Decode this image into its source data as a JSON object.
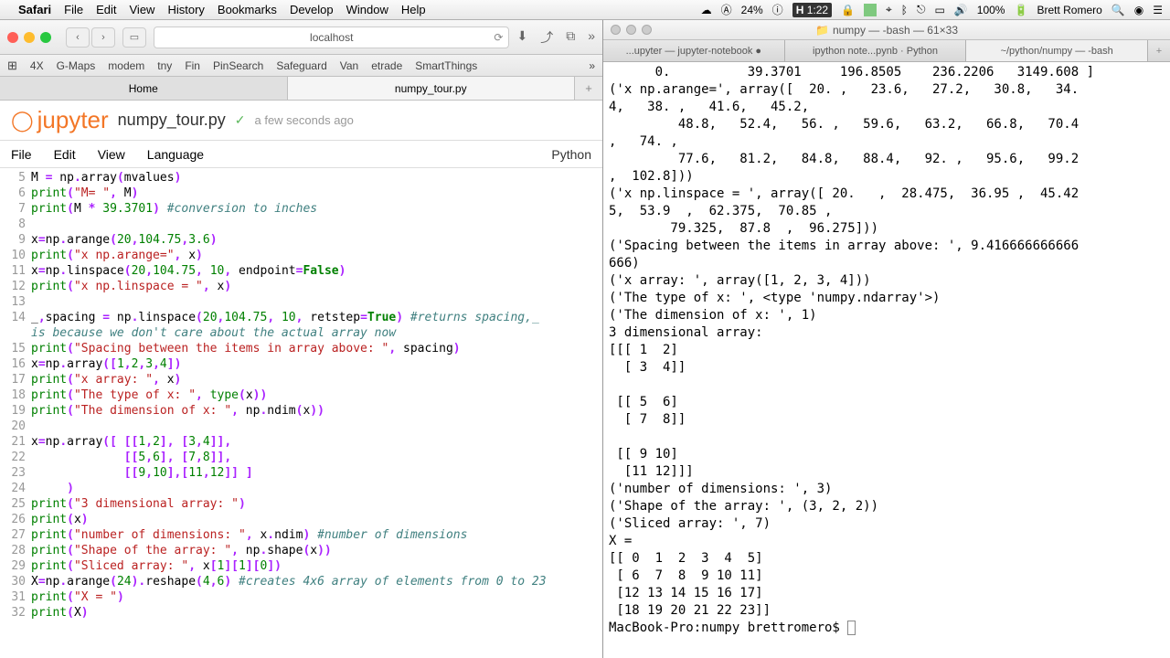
{
  "menubar": {
    "app": "Safari",
    "items": [
      "File",
      "Edit",
      "View",
      "History",
      "Bookmarks",
      "Develop",
      "Window",
      "Help"
    ],
    "zoom": "24%",
    "time": "1:22",
    "battery": "100%",
    "user": "Brett Romero"
  },
  "safari": {
    "url": "localhost",
    "favorites": [
      "4X",
      "G-Maps",
      "modem",
      "tny",
      "Fin",
      "PinSearch",
      "Safeguard",
      "Van",
      "etrade",
      "SmartThings"
    ],
    "tabs": [
      "Home",
      "numpy_tour.py"
    ],
    "active_tab": 1
  },
  "jupyter": {
    "logo": "jupyter",
    "filename": "numpy_tour.py",
    "saved": "a few seconds ago",
    "menu": [
      "File",
      "Edit",
      "View",
      "Language"
    ],
    "kernel": "Python"
  },
  "code": [
    {
      "n": 5,
      "tokens": [
        [
          "",
          "M "
        ],
        [
          "op",
          "="
        ],
        [
          "",
          " np"
        ],
        [
          "op",
          "."
        ],
        [
          "",
          "array"
        ],
        [
          "op",
          "("
        ],
        [
          "",
          "mvalues"
        ],
        [
          "op",
          ")"
        ]
      ]
    },
    {
      "n": 6,
      "tokens": [
        [
          "builtin",
          "print"
        ],
        [
          "op",
          "("
        ],
        [
          "str",
          "\"M= \""
        ],
        [
          "op",
          ","
        ],
        [
          "",
          " M"
        ],
        [
          "op",
          ")"
        ]
      ]
    },
    {
      "n": 7,
      "tokens": [
        [
          "builtin",
          "print"
        ],
        [
          "op",
          "("
        ],
        [
          "",
          "M "
        ],
        [
          "op",
          "*"
        ],
        [
          "",
          " "
        ],
        [
          "num",
          "39.3701"
        ],
        [
          "op",
          ")"
        ],
        [
          "",
          " "
        ],
        [
          "com",
          "#conversion to inches"
        ]
      ]
    },
    {
      "n": 8,
      "tokens": []
    },
    {
      "n": 9,
      "tokens": [
        [
          "",
          "x"
        ],
        [
          "op",
          "="
        ],
        [
          "",
          "np"
        ],
        [
          "op",
          "."
        ],
        [
          "",
          "arange"
        ],
        [
          "op",
          "("
        ],
        [
          "num",
          "20"
        ],
        [
          "op",
          ","
        ],
        [
          "num",
          "104.75"
        ],
        [
          "op",
          ","
        ],
        [
          "num",
          "3.6"
        ],
        [
          "op",
          ")"
        ]
      ]
    },
    {
      "n": 10,
      "tokens": [
        [
          "builtin",
          "print"
        ],
        [
          "op",
          "("
        ],
        [
          "str",
          "\"x np.arange=\""
        ],
        [
          "op",
          ","
        ],
        [
          "",
          " x"
        ],
        [
          "op",
          ")"
        ]
      ]
    },
    {
      "n": 11,
      "tokens": [
        [
          "",
          "x"
        ],
        [
          "op",
          "="
        ],
        [
          "",
          "np"
        ],
        [
          "op",
          "."
        ],
        [
          "",
          "linspace"
        ],
        [
          "op",
          "("
        ],
        [
          "num",
          "20"
        ],
        [
          "op",
          ","
        ],
        [
          "num",
          "104.75"
        ],
        [
          "op",
          ","
        ],
        [
          "",
          " "
        ],
        [
          "num",
          "10"
        ],
        [
          "op",
          ","
        ],
        [
          "",
          " endpoint"
        ],
        [
          "op",
          "="
        ],
        [
          "bool",
          "False"
        ],
        [
          "op",
          ")"
        ]
      ]
    },
    {
      "n": 12,
      "tokens": [
        [
          "builtin",
          "print"
        ],
        [
          "op",
          "("
        ],
        [
          "str",
          "\"x np.linspace = \""
        ],
        [
          "op",
          ","
        ],
        [
          "",
          " x"
        ],
        [
          "op",
          ")"
        ]
      ]
    },
    {
      "n": 13,
      "tokens": []
    },
    {
      "n": 14,
      "tokens": [
        [
          "",
          "_"
        ],
        [
          "op",
          ","
        ],
        [
          "",
          "spacing "
        ],
        [
          "op",
          "="
        ],
        [
          "",
          " np"
        ],
        [
          "op",
          "."
        ],
        [
          "",
          "linspace"
        ],
        [
          "op",
          "("
        ],
        [
          "num",
          "20"
        ],
        [
          "op",
          ","
        ],
        [
          "num",
          "104.75"
        ],
        [
          "op",
          ","
        ],
        [
          "",
          " "
        ],
        [
          "num",
          "10"
        ],
        [
          "op",
          ","
        ],
        [
          "",
          " retstep"
        ],
        [
          "op",
          "="
        ],
        [
          "bool",
          "True"
        ],
        [
          "op",
          ")"
        ],
        [
          "",
          " "
        ],
        [
          "com",
          "#returns spacing,_ "
        ]
      ]
    },
    {
      "n": "",
      "tokens": [
        [
          "com",
          "is because we don't care about the actual array now"
        ]
      ]
    },
    {
      "n": 15,
      "tokens": [
        [
          "builtin",
          "print"
        ],
        [
          "op",
          "("
        ],
        [
          "str",
          "\"Spacing between the items in array above: \""
        ],
        [
          "op",
          ","
        ],
        [
          "",
          " spacing"
        ],
        [
          "op",
          ")"
        ]
      ]
    },
    {
      "n": 16,
      "tokens": [
        [
          "",
          "x"
        ],
        [
          "op",
          "="
        ],
        [
          "",
          "np"
        ],
        [
          "op",
          "."
        ],
        [
          "",
          "array"
        ],
        [
          "op",
          "("
        ],
        [
          "op",
          "["
        ],
        [
          "num",
          "1"
        ],
        [
          "op",
          ","
        ],
        [
          "num",
          "2"
        ],
        [
          "op",
          ","
        ],
        [
          "num",
          "3"
        ],
        [
          "op",
          ","
        ],
        [
          "num",
          "4"
        ],
        [
          "op",
          "]"
        ],
        [
          "op",
          ")"
        ]
      ]
    },
    {
      "n": 17,
      "tokens": [
        [
          "builtin",
          "print"
        ],
        [
          "op",
          "("
        ],
        [
          "str",
          "\"x array: \""
        ],
        [
          "op",
          ","
        ],
        [
          "",
          " x"
        ],
        [
          "op",
          ")"
        ]
      ]
    },
    {
      "n": 18,
      "tokens": [
        [
          "builtin",
          "print"
        ],
        [
          "op",
          "("
        ],
        [
          "str",
          "\"The type of x: \""
        ],
        [
          "op",
          ","
        ],
        [
          "",
          " "
        ],
        [
          "builtin",
          "type"
        ],
        [
          "op",
          "("
        ],
        [
          "",
          "x"
        ],
        [
          "op",
          ")"
        ],
        [
          "op",
          ")"
        ]
      ]
    },
    {
      "n": 19,
      "tokens": [
        [
          "builtin",
          "print"
        ],
        [
          "op",
          "("
        ],
        [
          "str",
          "\"The dimension of x: \""
        ],
        [
          "op",
          ","
        ],
        [
          "",
          " np"
        ],
        [
          "op",
          "."
        ],
        [
          "",
          "ndim"
        ],
        [
          "op",
          "("
        ],
        [
          "",
          "x"
        ],
        [
          "op",
          ")"
        ],
        [
          "op",
          ")"
        ]
      ]
    },
    {
      "n": 20,
      "tokens": []
    },
    {
      "n": 21,
      "tokens": [
        [
          "",
          "x"
        ],
        [
          "op",
          "="
        ],
        [
          "",
          "np"
        ],
        [
          "op",
          "."
        ],
        [
          "",
          "array"
        ],
        [
          "op",
          "("
        ],
        [
          "op",
          "["
        ],
        [
          "",
          " "
        ],
        [
          "op",
          "["
        ],
        [
          "op",
          "["
        ],
        [
          "num",
          "1"
        ],
        [
          "op",
          ","
        ],
        [
          "num",
          "2"
        ],
        [
          "op",
          "]"
        ],
        [
          "op",
          ","
        ],
        [
          "",
          " "
        ],
        [
          "op",
          "["
        ],
        [
          "num",
          "3"
        ],
        [
          "op",
          ","
        ],
        [
          "num",
          "4"
        ],
        [
          "op",
          "]"
        ],
        [
          "op",
          "]"
        ],
        [
          "op",
          ","
        ]
      ]
    },
    {
      "n": 22,
      "tokens": [
        [
          "",
          "             "
        ],
        [
          "op",
          "["
        ],
        [
          "op",
          "["
        ],
        [
          "num",
          "5"
        ],
        [
          "op",
          ","
        ],
        [
          "num",
          "6"
        ],
        [
          "op",
          "]"
        ],
        [
          "op",
          ","
        ],
        [
          "",
          " "
        ],
        [
          "op",
          "["
        ],
        [
          "num",
          "7"
        ],
        [
          "op",
          ","
        ],
        [
          "num",
          "8"
        ],
        [
          "op",
          "]"
        ],
        [
          "op",
          "]"
        ],
        [
          "op",
          ","
        ]
      ]
    },
    {
      "n": 23,
      "tokens": [
        [
          "",
          "             "
        ],
        [
          "op",
          "["
        ],
        [
          "op",
          "["
        ],
        [
          "num",
          "9"
        ],
        [
          "op",
          ","
        ],
        [
          "num",
          "10"
        ],
        [
          "op",
          "]"
        ],
        [
          "op",
          ","
        ],
        [
          "op",
          "["
        ],
        [
          "num",
          "11"
        ],
        [
          "op",
          ","
        ],
        [
          "num",
          "12"
        ],
        [
          "op",
          "]"
        ],
        [
          "op",
          "]"
        ],
        [
          "",
          " "
        ],
        [
          "op",
          "]"
        ]
      ]
    },
    {
      "n": 24,
      "tokens": [
        [
          "",
          "     "
        ],
        [
          "op",
          ")"
        ]
      ]
    },
    {
      "n": 25,
      "tokens": [
        [
          "builtin",
          "print"
        ],
        [
          "op",
          "("
        ],
        [
          "str",
          "\"3 dimensional array: \""
        ],
        [
          "op",
          ")"
        ]
      ]
    },
    {
      "n": 26,
      "tokens": [
        [
          "builtin",
          "print"
        ],
        [
          "op",
          "("
        ],
        [
          "",
          "x"
        ],
        [
          "op",
          ")"
        ]
      ]
    },
    {
      "n": 27,
      "tokens": [
        [
          "builtin",
          "print"
        ],
        [
          "op",
          "("
        ],
        [
          "str",
          "\"number of dimensions: \""
        ],
        [
          "op",
          ","
        ],
        [
          "",
          " x"
        ],
        [
          "op",
          "."
        ],
        [
          "",
          "ndim"
        ],
        [
          "op",
          ")"
        ],
        [
          "",
          " "
        ],
        [
          "com",
          "#number of dimensions"
        ]
      ]
    },
    {
      "n": 28,
      "tokens": [
        [
          "builtin",
          "print"
        ],
        [
          "op",
          "("
        ],
        [
          "str",
          "\"Shape of the array: \""
        ],
        [
          "op",
          ","
        ],
        [
          "",
          " np"
        ],
        [
          "op",
          "."
        ],
        [
          "",
          "shape"
        ],
        [
          "op",
          "("
        ],
        [
          "",
          "x"
        ],
        [
          "op",
          ")"
        ],
        [
          "op",
          ")"
        ]
      ]
    },
    {
      "n": 29,
      "tokens": [
        [
          "builtin",
          "print"
        ],
        [
          "op",
          "("
        ],
        [
          "str",
          "\"Sliced array: \""
        ],
        [
          "op",
          ","
        ],
        [
          "",
          " x"
        ],
        [
          "op",
          "["
        ],
        [
          "num",
          "1"
        ],
        [
          "op",
          "]"
        ],
        [
          "op",
          "["
        ],
        [
          "num",
          "1"
        ],
        [
          "op",
          "]"
        ],
        [
          "op",
          "["
        ],
        [
          "num",
          "0"
        ],
        [
          "op",
          "]"
        ],
        [
          "op",
          ")"
        ]
      ]
    },
    {
      "n": 30,
      "tokens": [
        [
          "",
          "X"
        ],
        [
          "op",
          "="
        ],
        [
          "",
          "np"
        ],
        [
          "op",
          "."
        ],
        [
          "",
          "arange"
        ],
        [
          "op",
          "("
        ],
        [
          "num",
          "24"
        ],
        [
          "op",
          ")"
        ],
        [
          "op",
          "."
        ],
        [
          "",
          "reshape"
        ],
        [
          "op",
          "("
        ],
        [
          "num",
          "4"
        ],
        [
          "op",
          ","
        ],
        [
          "num",
          "6"
        ],
        [
          "op",
          ")"
        ],
        [
          "",
          " "
        ],
        [
          "com",
          "#creates 4x6 array of elements from 0 to 23"
        ]
      ]
    },
    {
      "n": 31,
      "tokens": [
        [
          "builtin",
          "print"
        ],
        [
          "op",
          "("
        ],
        [
          "str",
          "\"X = \""
        ],
        [
          "op",
          ")"
        ]
      ]
    },
    {
      "n": 32,
      "tokens": [
        [
          "builtin",
          "print"
        ],
        [
          "op",
          "("
        ],
        [
          "",
          "X"
        ],
        [
          "op",
          ")"
        ]
      ]
    }
  ],
  "terminal": {
    "title": "numpy — -bash — 61×33",
    "tabs": [
      "...upyter — jupyter-notebook  ●",
      "ipython note...pynb · Python",
      "~/python/numpy — -bash"
    ],
    "active_tab": 2,
    "prompt": "MacBook-Pro:numpy brettromero$ ",
    "lines": [
      "      0.          39.3701     196.8505    236.2206   3149.608 ]",
      "('x np.arange=', array([  20. ,   23.6,   27.2,   30.8,   34.",
      "4,   38. ,   41.6,   45.2,",
      "         48.8,   52.4,   56. ,   59.6,   63.2,   66.8,   70.4",
      ",   74. ,",
      "         77.6,   81.2,   84.8,   88.4,   92. ,   95.6,   99.2",
      ",  102.8]))",
      "('x np.linspace = ', array([ 20.   ,  28.475,  36.95 ,  45.42",
      "5,  53.9  ,  62.375,  70.85 ,",
      "        79.325,  87.8  ,  96.275]))",
      "('Spacing between the items in array above: ', 9.416666666666",
      "666)",
      "('x array: ', array([1, 2, 3, 4]))",
      "('The type of x: ', <type 'numpy.ndarray'>)",
      "('The dimension of x: ', 1)",
      "3 dimensional array: ",
      "[[[ 1  2]",
      "  [ 3  4]]",
      "",
      " [[ 5  6]",
      "  [ 7  8]]",
      "",
      " [[ 9 10]",
      "  [11 12]]]",
      "('number of dimensions: ', 3)",
      "('Shape of the array: ', (3, 2, 2))",
      "('Sliced array: ', 7)",
      "X = ",
      "[[ 0  1  2  3  4  5]",
      " [ 6  7  8  9 10 11]",
      " [12 13 14 15 16 17]",
      " [18 19 20 21 22 23]]"
    ]
  }
}
